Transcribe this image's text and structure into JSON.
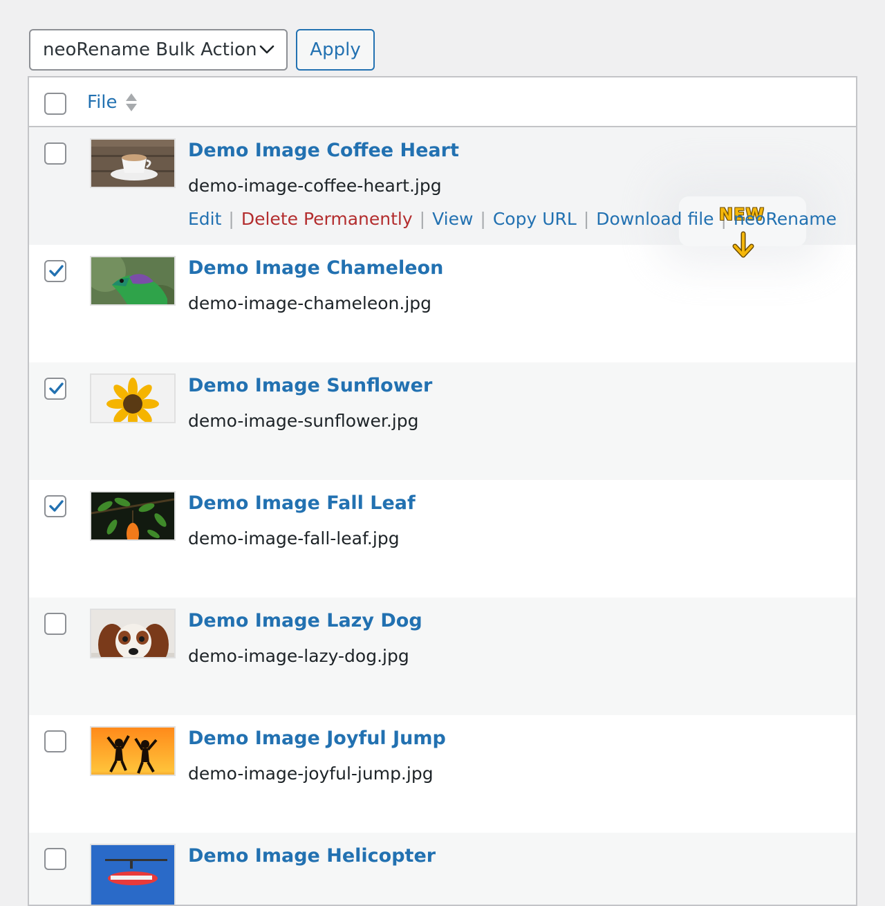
{
  "toolbar": {
    "bulk_action_value": "neoRename Bulk Action",
    "apply_label": "Apply"
  },
  "table": {
    "header": {
      "file_label": "File"
    },
    "rows": [
      {
        "title": "Demo Image Coffee Heart",
        "filename": "demo-image-coffee-heart.jpg",
        "checked": false,
        "actions": [
          "Edit",
          "Delete Permanently",
          "View",
          "Copy URL",
          "Download file",
          "neoRename"
        ]
      },
      {
        "title": "Demo Image Chameleon",
        "filename": "demo-image-chameleon.jpg",
        "checked": true
      },
      {
        "title": "Demo Image Sunflower",
        "filename": "demo-image-sunflower.jpg",
        "checked": true
      },
      {
        "title": "Demo Image Fall Leaf",
        "filename": "demo-image-fall-leaf.jpg",
        "checked": true
      },
      {
        "title": "Demo Image Lazy Dog",
        "filename": "demo-image-lazy-dog.jpg",
        "checked": false
      },
      {
        "title": "Demo Image Joyful Jump",
        "filename": "demo-image-joyful-jump.jpg",
        "checked": false
      },
      {
        "title": "Demo Image Helicopter",
        "filename": "",
        "checked": false
      }
    ]
  },
  "callout": {
    "badge": "NEW"
  },
  "colors": {
    "link": "#2271b1",
    "delete": "#b32d2e",
    "badge": "#f5b70a",
    "background": "#f0f0f1"
  }
}
